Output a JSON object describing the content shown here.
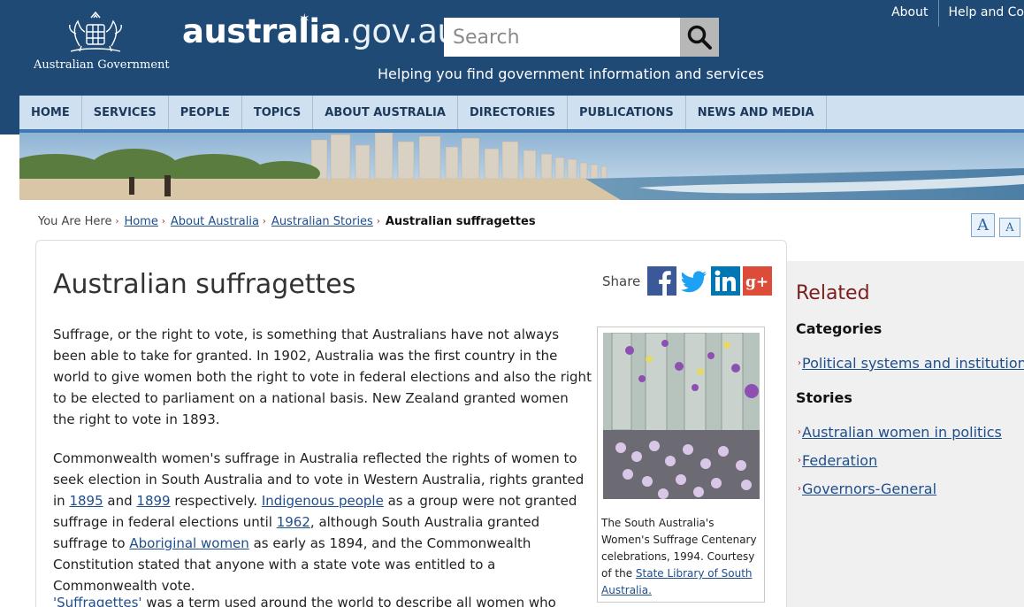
{
  "header": {
    "brand_main": "australia",
    "brand_suffix": ".gov.au",
    "crest_label": "Australian Government",
    "search_placeholder": "Search",
    "tagline": "Helping you find government information and services",
    "top_links": [
      "About",
      "Help and Co"
    ]
  },
  "nav": {
    "items": [
      "HOME",
      "SERVICES",
      "PEOPLE",
      "TOPICS",
      "ABOUT AUSTRALIA",
      "DIRECTORIES",
      "PUBLICATIONS",
      "NEWS AND MEDIA"
    ]
  },
  "breadcrumb": {
    "prefix": "You Are Here",
    "links": [
      "Home",
      "About Australia",
      "Australian Stories"
    ],
    "current": "Australian suffragettes"
  },
  "font_controls": {
    "increase": "A",
    "decrease": "A"
  },
  "article": {
    "title": "Australian suffragettes",
    "share_label": "Share",
    "share_icons": [
      "facebook-icon",
      "twitter-icon",
      "linkedin-icon",
      "google-plus-icon"
    ],
    "p1": "Suffrage, or the right to vote, is something that Australians have not always been able to take for granted. In 1902, Australia was the first country in the world to give women both the right to vote in federal elections and also the right to be elected to parliament on a national basis. New Zealand granted women the right to vote in 1893.",
    "p2": {
      "t1": "Commonwealth women's suffrage in Australia reflected the rights of women to seek election in South Australia and to vote in Western Australia, rights granted in ",
      "l1": "1895",
      "t2": " and ",
      "l2": "1899",
      "t3": " respectively. ",
      "l3": "Indigenous people",
      "t4": " as a group were not granted suffrage in federal elections until ",
      "l4": "1962",
      "t5": ", although South Australia granted suffrage to ",
      "l5": "Aboriginal women",
      "t6": " as early as 1894, and the Commonwealth Constitution stated that anyone with a state vote was entitled to a Commonwealth vote."
    },
    "p3": {
      "l1": "'Suffragettes'",
      "t1": " was a term used around the world to describe all women who"
    },
    "figure": {
      "caption": "The South Australia's Women's Suffrage Centenary celebrations, 1994. Courtesy of the ",
      "caption_link": "State Library of South Australia."
    }
  },
  "related": {
    "title": "Related",
    "categories_heading": "Categories",
    "categories": [
      "Political systems and institutions"
    ],
    "stories_heading": "Stories",
    "stories": [
      "Australian women in politics",
      "Federation",
      "Governors-General"
    ]
  },
  "colors": {
    "header_bg": "#1e4a75",
    "nav_bg": "#cfe0f1",
    "link": "#1f4e8c",
    "related_title": "#7a1e1e"
  }
}
